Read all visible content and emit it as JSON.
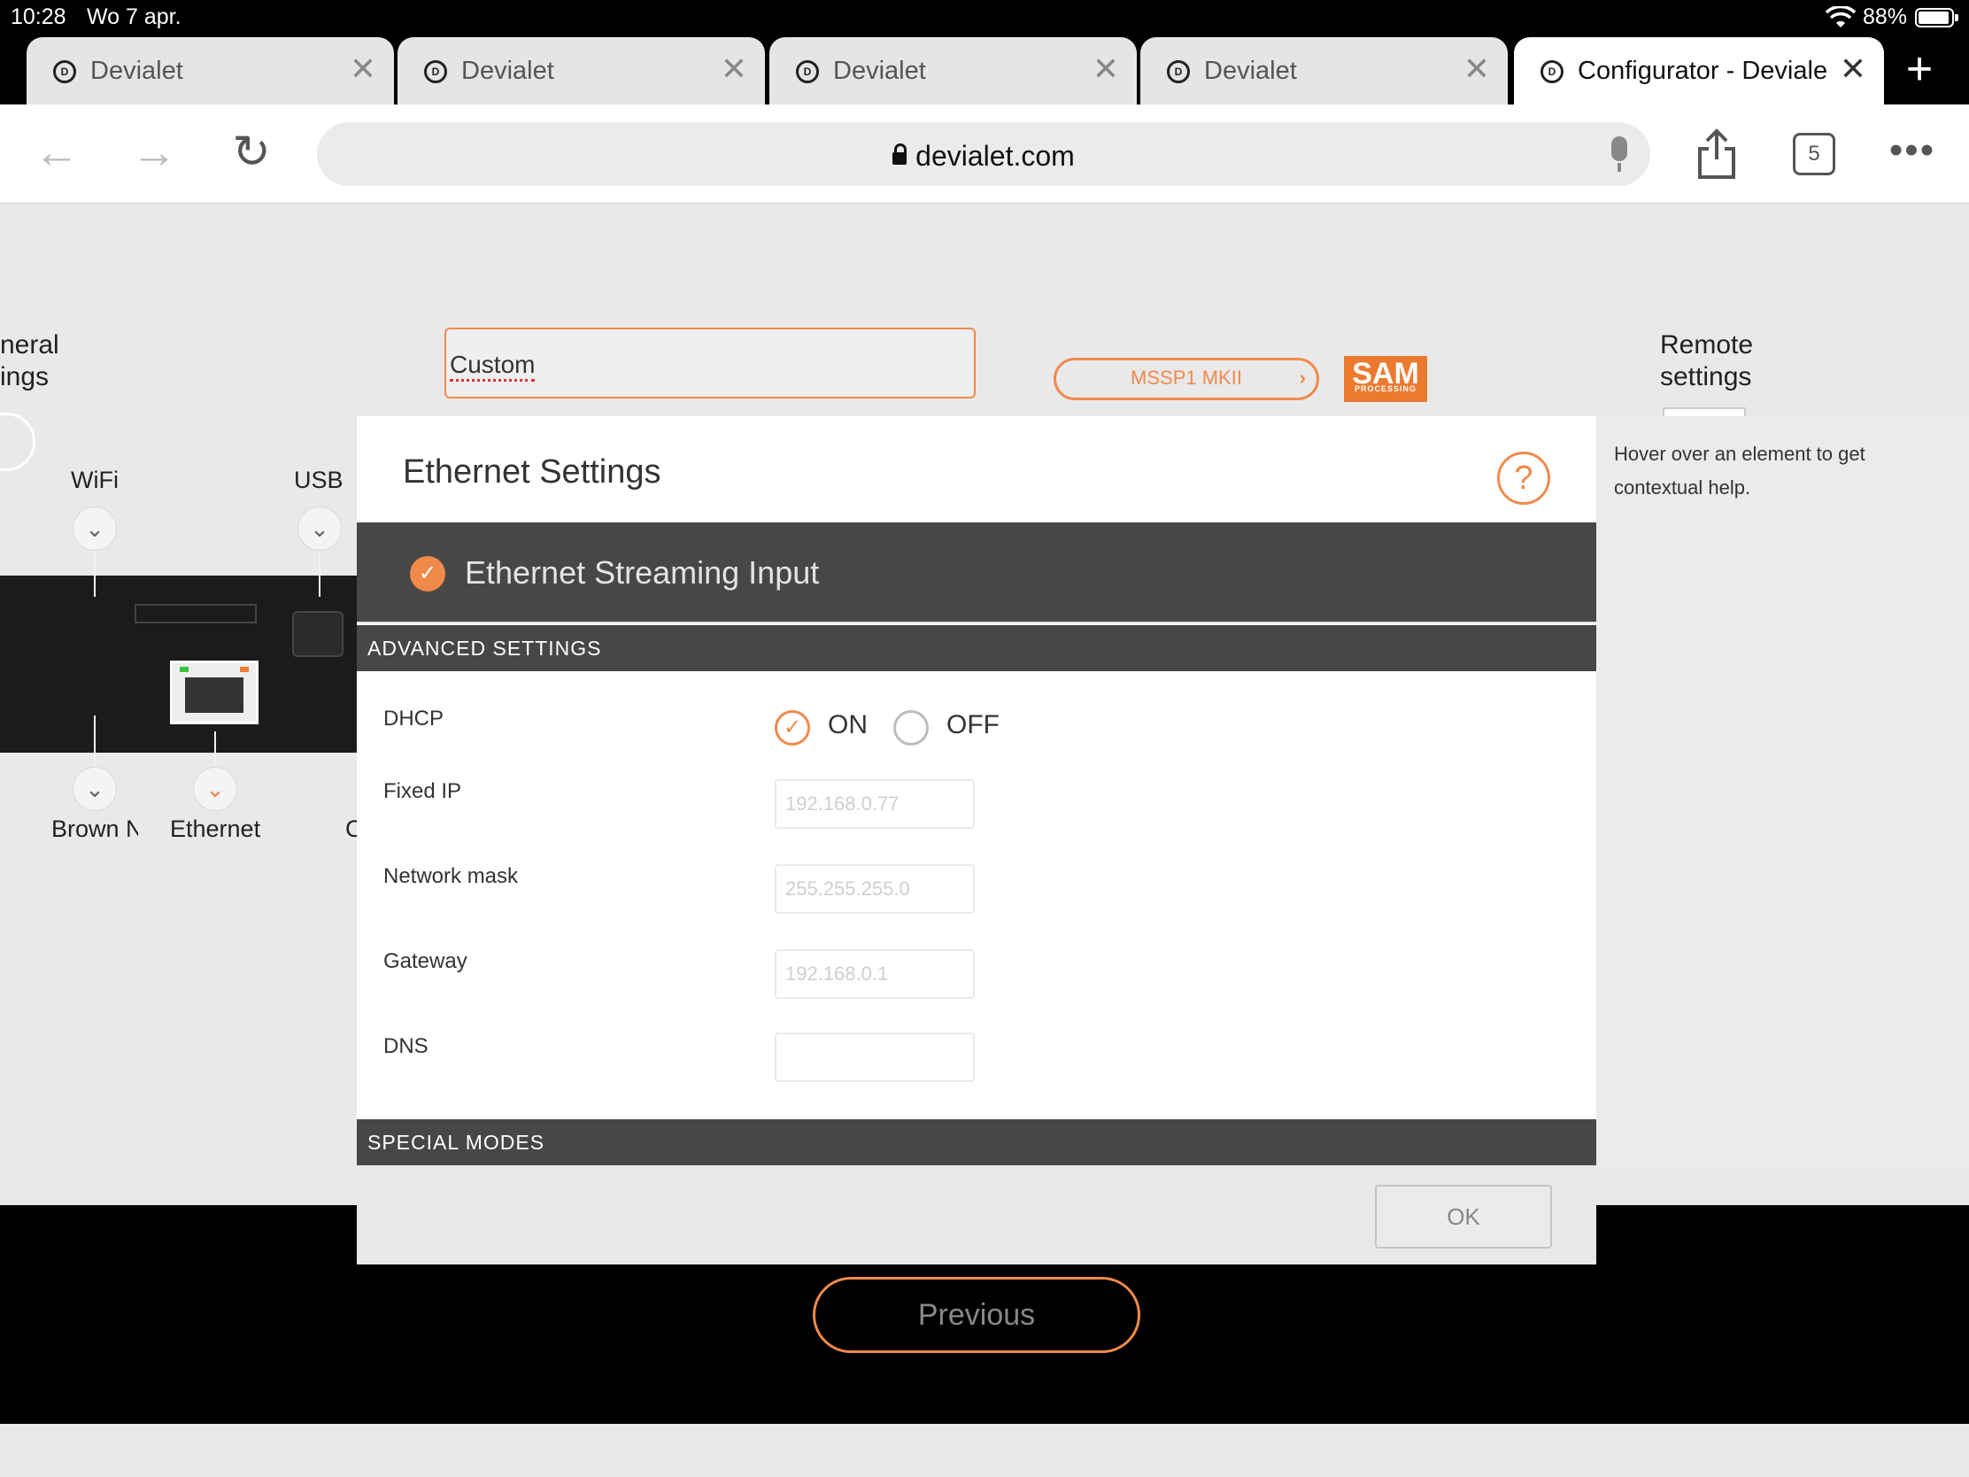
{
  "status_bar": {
    "time": "10:28",
    "date": "Wo 7 apr.",
    "battery": "88%"
  },
  "browser": {
    "tabs": [
      {
        "title": "Devialet"
      },
      {
        "title": "Devialet"
      },
      {
        "title": "Devialet"
      },
      {
        "title": "Devialet"
      },
      {
        "title": "Configurator - Devialet"
      }
    ],
    "url": "devialet.com",
    "tab_count": "5"
  },
  "background": {
    "general_settings": "neral\nings",
    "remote_settings": "Remote\nsettings",
    "preset_name": "Custom",
    "product_button": "MSSP1 MKII",
    "sam_logo": "SAM",
    "sam_sub": "PROCESSING",
    "connectors": {
      "wifi": "WiFi",
      "usb": "USB",
      "brown": "Brown N",
      "ethernet": "Ethernet",
      "cut": "C"
    },
    "previous_button": "Previous"
  },
  "modal": {
    "title": "Ethernet Settings",
    "help": "?",
    "streaming_input": "Ethernet Streaming Input",
    "advanced_header": "ADVANCED SETTINGS",
    "dhcp": {
      "label": "DHCP",
      "on": "ON",
      "off": "OFF"
    },
    "fixed_ip": {
      "label": "Fixed IP",
      "value": "192.168.0.77"
    },
    "network_mask": {
      "label": "Network mask",
      "value": "255.255.255.0"
    },
    "gateway": {
      "label": "Gateway",
      "value": "192.168.0.1"
    },
    "dns": {
      "label": "DNS",
      "value": ""
    },
    "special_header": "SPECIAL MODES",
    "ok": "OK"
  },
  "help_pane": {
    "text": "Hover over an element to get contextual help."
  },
  "colors": {
    "accent": "#f08a4b",
    "dark_bar": "#474747"
  }
}
